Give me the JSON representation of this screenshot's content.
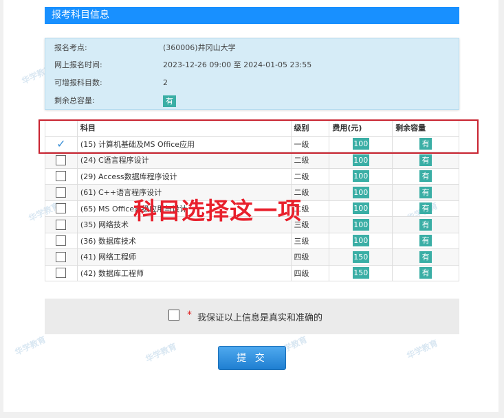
{
  "header": {
    "title": "报考科目信息"
  },
  "info": {
    "rows": [
      {
        "label": "报名考点:",
        "value": "(360006)井冈山大学"
      },
      {
        "label": "网上报名时间:",
        "value": "2023-12-26 09:00 至 2024-01-05 23:55"
      },
      {
        "label": "可增报科目数:",
        "value": "2"
      },
      {
        "label": "剩余总容量:",
        "value": "有"
      }
    ]
  },
  "table": {
    "headers": [
      "",
      "科目",
      "级别",
      "费用(元)",
      "剩余容量"
    ],
    "rows": [
      {
        "checked": true,
        "name": "(15) 计算机基础及MS Office应用",
        "level": "一级",
        "fee": "100",
        "remaining": "有"
      },
      {
        "checked": false,
        "name": "(24) C语言程序设计",
        "level": "二级",
        "fee": "100",
        "remaining": "有"
      },
      {
        "checked": false,
        "name": "(29) Access数据库程序设计",
        "level": "二级",
        "fee": "100",
        "remaining": "有"
      },
      {
        "checked": false,
        "name": "(61) C++语言程序设计",
        "level": "二级",
        "fee": "100",
        "remaining": "有"
      },
      {
        "checked": false,
        "name": "(65) MS Office高级应用与设计",
        "level": "二级",
        "fee": "100",
        "remaining": "有"
      },
      {
        "checked": false,
        "name": "(35) 网络技术",
        "level": "三级",
        "fee": "100",
        "remaining": "有"
      },
      {
        "checked": false,
        "name": "(36) 数据库技术",
        "level": "三级",
        "fee": "100",
        "remaining": "有"
      },
      {
        "checked": false,
        "name": "(41) 网络工程师",
        "level": "四级",
        "fee": "150",
        "remaining": "有"
      },
      {
        "checked": false,
        "name": "(42) 数据库工程师",
        "level": "四级",
        "fee": "150",
        "remaining": "有"
      }
    ]
  },
  "annotation": {
    "text": "科目选择这一项"
  },
  "agreement": {
    "required_mark": "*",
    "text": "我保证以上信息是真实和准确的"
  },
  "submit": {
    "label": "提 交"
  },
  "watermark": {
    "text": "华学教育"
  },
  "colors": {
    "header_bg": "#1890ff",
    "badge": "#3aaea5",
    "highlight": "#c8222f",
    "annotation": "#e8202c"
  }
}
